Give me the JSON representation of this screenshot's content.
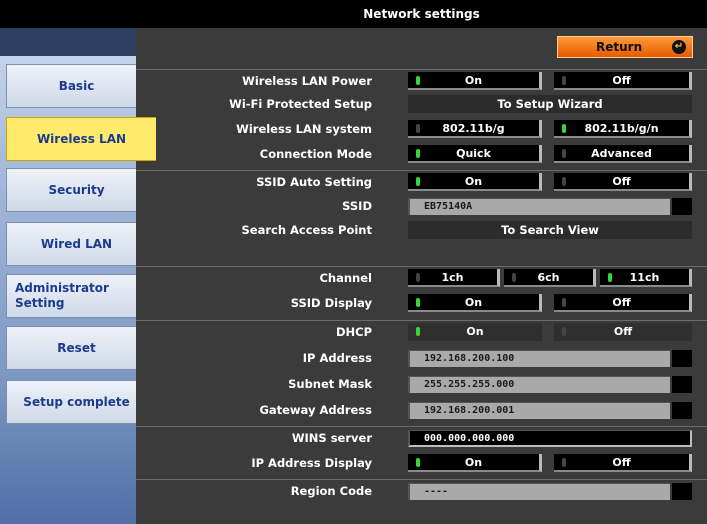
{
  "window": {
    "title": "Network settings"
  },
  "return_button": {
    "label": "Return"
  },
  "sidebar": {
    "items": [
      {
        "label": "Basic"
      },
      {
        "label": "Wireless LAN"
      },
      {
        "label": "Security"
      },
      {
        "label": "Wired LAN"
      },
      {
        "label": "Administrator Setting"
      },
      {
        "label": "Reset"
      },
      {
        "label": "Setup complete"
      }
    ],
    "active": "Wireless LAN"
  },
  "settings": {
    "wireless_lan_power": {
      "label": "Wireless LAN Power",
      "options": [
        "On",
        "Off"
      ],
      "selected": "On"
    },
    "wps": {
      "label": "Wi-Fi Protected Setup",
      "action": "To Setup Wizard"
    },
    "wireless_system": {
      "label": "Wireless LAN system",
      "options": [
        "802.11b/g",
        "802.11b/g/n"
      ],
      "selected": "802.11b/g/n"
    },
    "connection_mode": {
      "label": "Connection Mode",
      "options": [
        "Quick",
        "Advanced"
      ],
      "selected": "Quick"
    },
    "ssid_auto": {
      "label": "SSID Auto Setting",
      "options": [
        "On",
        "Off"
      ],
      "selected": "On"
    },
    "ssid": {
      "label": "SSID",
      "value": "EB75140A"
    },
    "search_ap": {
      "label": "Search Access Point",
      "action": "To Search View"
    },
    "channel": {
      "label": "Channel",
      "options": [
        "1ch",
        "6ch",
        "11ch"
      ],
      "selected": "11ch"
    },
    "ssid_display": {
      "label": "SSID Display",
      "options": [
        "On",
        "Off"
      ],
      "selected": "On"
    },
    "dhcp": {
      "label": "DHCP",
      "options": [
        "On",
        "Off"
      ],
      "selected": "On"
    },
    "ip_address": {
      "label": "IP Address",
      "value": "192.168.200.100"
    },
    "subnet_mask": {
      "label": "Subnet Mask",
      "value": "255.255.255.000"
    },
    "gateway": {
      "label": "Gateway Address",
      "value": "192.168.200.001"
    },
    "wins": {
      "label": "WINS server",
      "value": "000.000.000.000"
    },
    "ip_display": {
      "label": "IP Address Display",
      "options": [
        "On",
        "Off"
      ],
      "selected": "On"
    },
    "region_code": {
      "label": "Region Code",
      "value": "----"
    }
  },
  "colors": {
    "active_tab": "#ffea6b",
    "return_button": "#f07010",
    "led_on": "#39d63a",
    "panel": "#3b3b3b"
  }
}
